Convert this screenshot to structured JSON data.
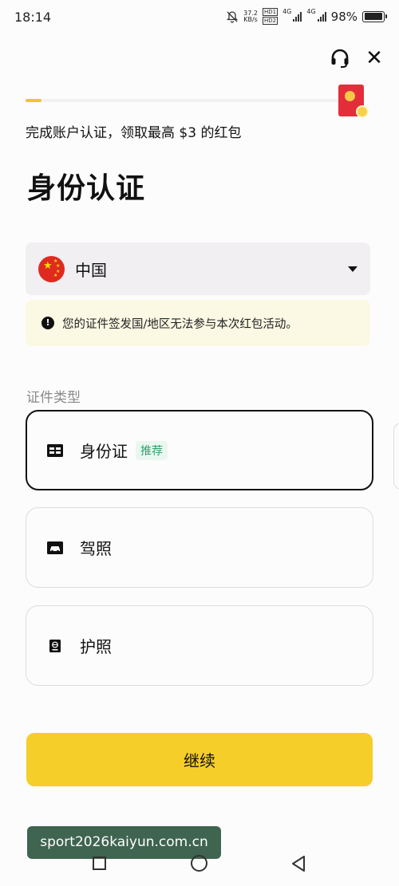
{
  "status_bar": {
    "time": "18:14",
    "net_speed_value": "37.2",
    "net_speed_unit": "KB/s",
    "hd_badge_1": "HD1",
    "hd_badge_2": "HD2",
    "net_type_1": "4G",
    "net_type_2": "4G",
    "battery": "98%",
    "battery_level": 0.98
  },
  "header": {
    "support_icon": "headset-icon",
    "close_icon": "close-icon",
    "close_glyph": "✕"
  },
  "progress": {
    "value": 0.05,
    "accent_color": "#f0c629"
  },
  "reward": {
    "icon": "red-envelope-icon",
    "promo_text": "完成账户认证，领取最高 $3 的红包"
  },
  "page": {
    "title": "身份认证"
  },
  "country": {
    "flag_icon": "china-flag-icon",
    "selected": "中国"
  },
  "warning": {
    "icon": "exclamation-icon",
    "glyph": "!",
    "text": "您的证件签发国/地区无法参与本次红包活动。"
  },
  "document": {
    "label": "证件类型",
    "options": [
      {
        "label": "身份证",
        "tag": "推荐",
        "icon": "id-card-icon",
        "selected": true
      },
      {
        "label": "驾照",
        "icon": "driver-license-icon",
        "selected": false
      },
      {
        "label": "护照",
        "icon": "passport-icon",
        "selected": false
      }
    ]
  },
  "actions": {
    "continue_label": "继续",
    "button_color": "#f6ce2a"
  },
  "watermark": {
    "text": "sport2026kaiyun.com.cn"
  },
  "nav": {
    "recents_icon": "square-icon",
    "home_icon": "circle-icon",
    "back_icon": "back-triangle-icon"
  }
}
